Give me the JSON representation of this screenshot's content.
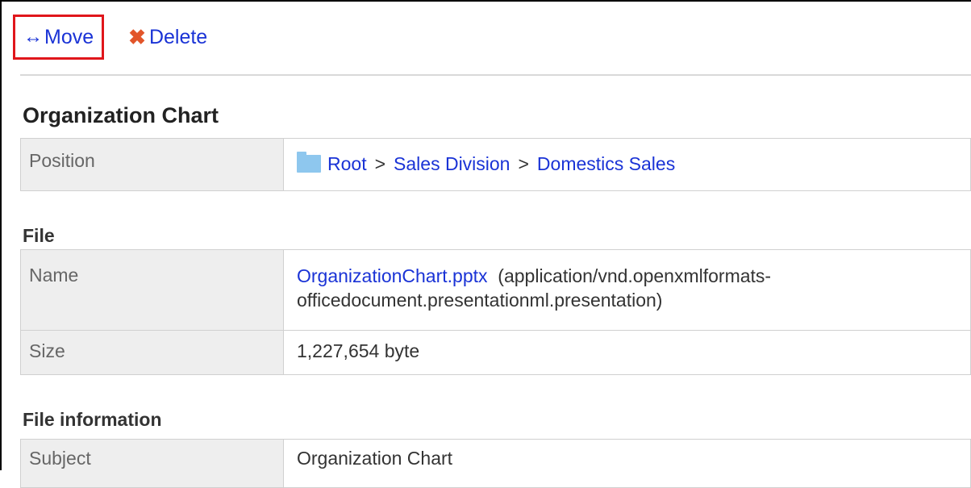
{
  "toolbar": {
    "move_icon": "↔",
    "move_label": "Move",
    "delete_icon": "✖",
    "delete_label": "Delete",
    "highlight_color": "#e0161b",
    "link_color": "#1a33d6"
  },
  "title": "Organization Chart",
  "position_section": {
    "key": "Position",
    "breadcrumb": [
      "Root",
      "Sales Division",
      "Domestics Sales"
    ],
    "separator": ">"
  },
  "file_section": {
    "label": "File",
    "name_key": "Name",
    "file_name": "OrganizationChart.pptx",
    "mime_line1": "(application/vnd.openxmlformats-",
    "mime_line2": "officedocument.presentationml.presentation)",
    "size_key": "Size",
    "size_value": "1,227,654 byte"
  },
  "file_info_section": {
    "label": "File information",
    "subject_key": "Subject",
    "subject_value": "Organization Chart"
  }
}
